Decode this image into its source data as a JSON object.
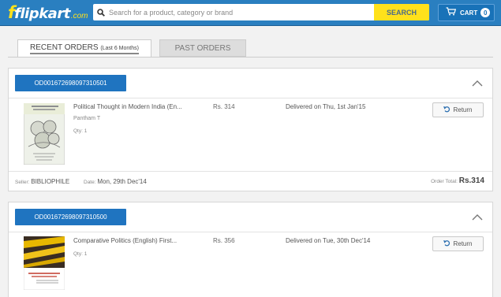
{
  "header": {
    "logo_text": "flipkart",
    "logo_domain": ".com",
    "search_placeholder": "Search for a product, category or brand",
    "search_button": "SEARCH",
    "cart_label": "CART",
    "cart_count": "0",
    "brand_yellow": "#ffe11b",
    "brand_blue": "#2a7fc0"
  },
  "tabs": {
    "recent_main": "RECENT ORDERS",
    "recent_sub": "(Last 6 Months)",
    "past": "PAST ORDERS"
  },
  "orders": [
    {
      "order_id": "OD001672698097310501",
      "title": "Political Thought in Modern India (En...",
      "author": "Pantham T",
      "qty": "Qty: 1",
      "price": "Rs. 314",
      "status": "Delivered on Thu, 1st Jan'15",
      "return_label": "Return",
      "seller_label": "Seller:",
      "seller": "BIBLIOPHILE",
      "date_label": "Date:",
      "date": "Mon, 29th Dec'14",
      "total_label": "Order Total:",
      "total": "Rs.314"
    },
    {
      "order_id": "OD001672698097310500",
      "title": "Comparative Politics (English) First...",
      "qty": "Qty: 1",
      "price": "Rs. 356",
      "status": "Delivered on Tue, 30th Dec'14",
      "return_label": "Return"
    }
  ],
  "icons": [
    "search-icon",
    "cart-icon",
    "chevron-up-icon",
    "return-arrow-icon"
  ]
}
